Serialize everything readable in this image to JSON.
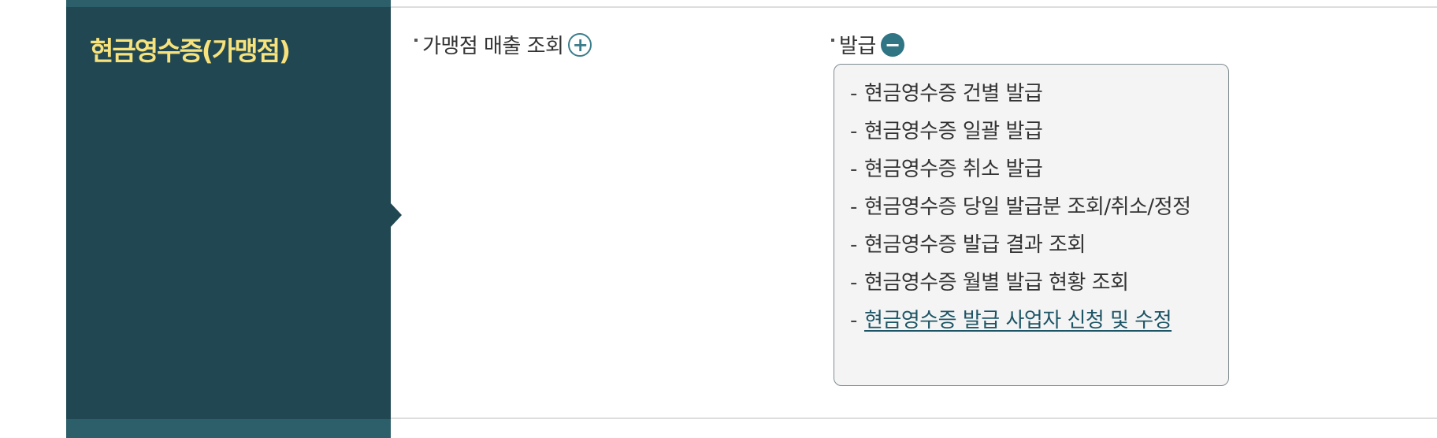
{
  "side": {
    "title": "현금영수증(가맹점)"
  },
  "menu": {
    "sales_inquiry": {
      "label": "가맹점 매출 조회",
      "toggle_icon": "plus-icon"
    },
    "issue": {
      "label": "발급",
      "toggle_icon": "minus-icon",
      "items": [
        {
          "dash": "-",
          "label": "현금영수증 건별 발급"
        },
        {
          "dash": "-",
          "label": "현금영수증 일괄 발급"
        },
        {
          "dash": "-",
          "label": "현금영수증 취소 발급"
        },
        {
          "dash": "-",
          "label": "현금영수증 당일 발급분 조회/취소/정정"
        },
        {
          "dash": "-",
          "label": "현금영수증 발급 결과 조회"
        },
        {
          "dash": "-",
          "label": "현금영수증 월별 발급 현황 조회"
        },
        {
          "dash": "-",
          "label": "현금영수증 발급 사업자 신청 및 수정"
        }
      ]
    }
  },
  "colors": {
    "panel_bg": "#214852",
    "panel_title": "#f7e27c",
    "accent": "#2f7584",
    "submenu_bg": "#f4f4f4",
    "active_link": "#1d5566"
  },
  "icons": {
    "plus": "+",
    "minus": "−"
  }
}
